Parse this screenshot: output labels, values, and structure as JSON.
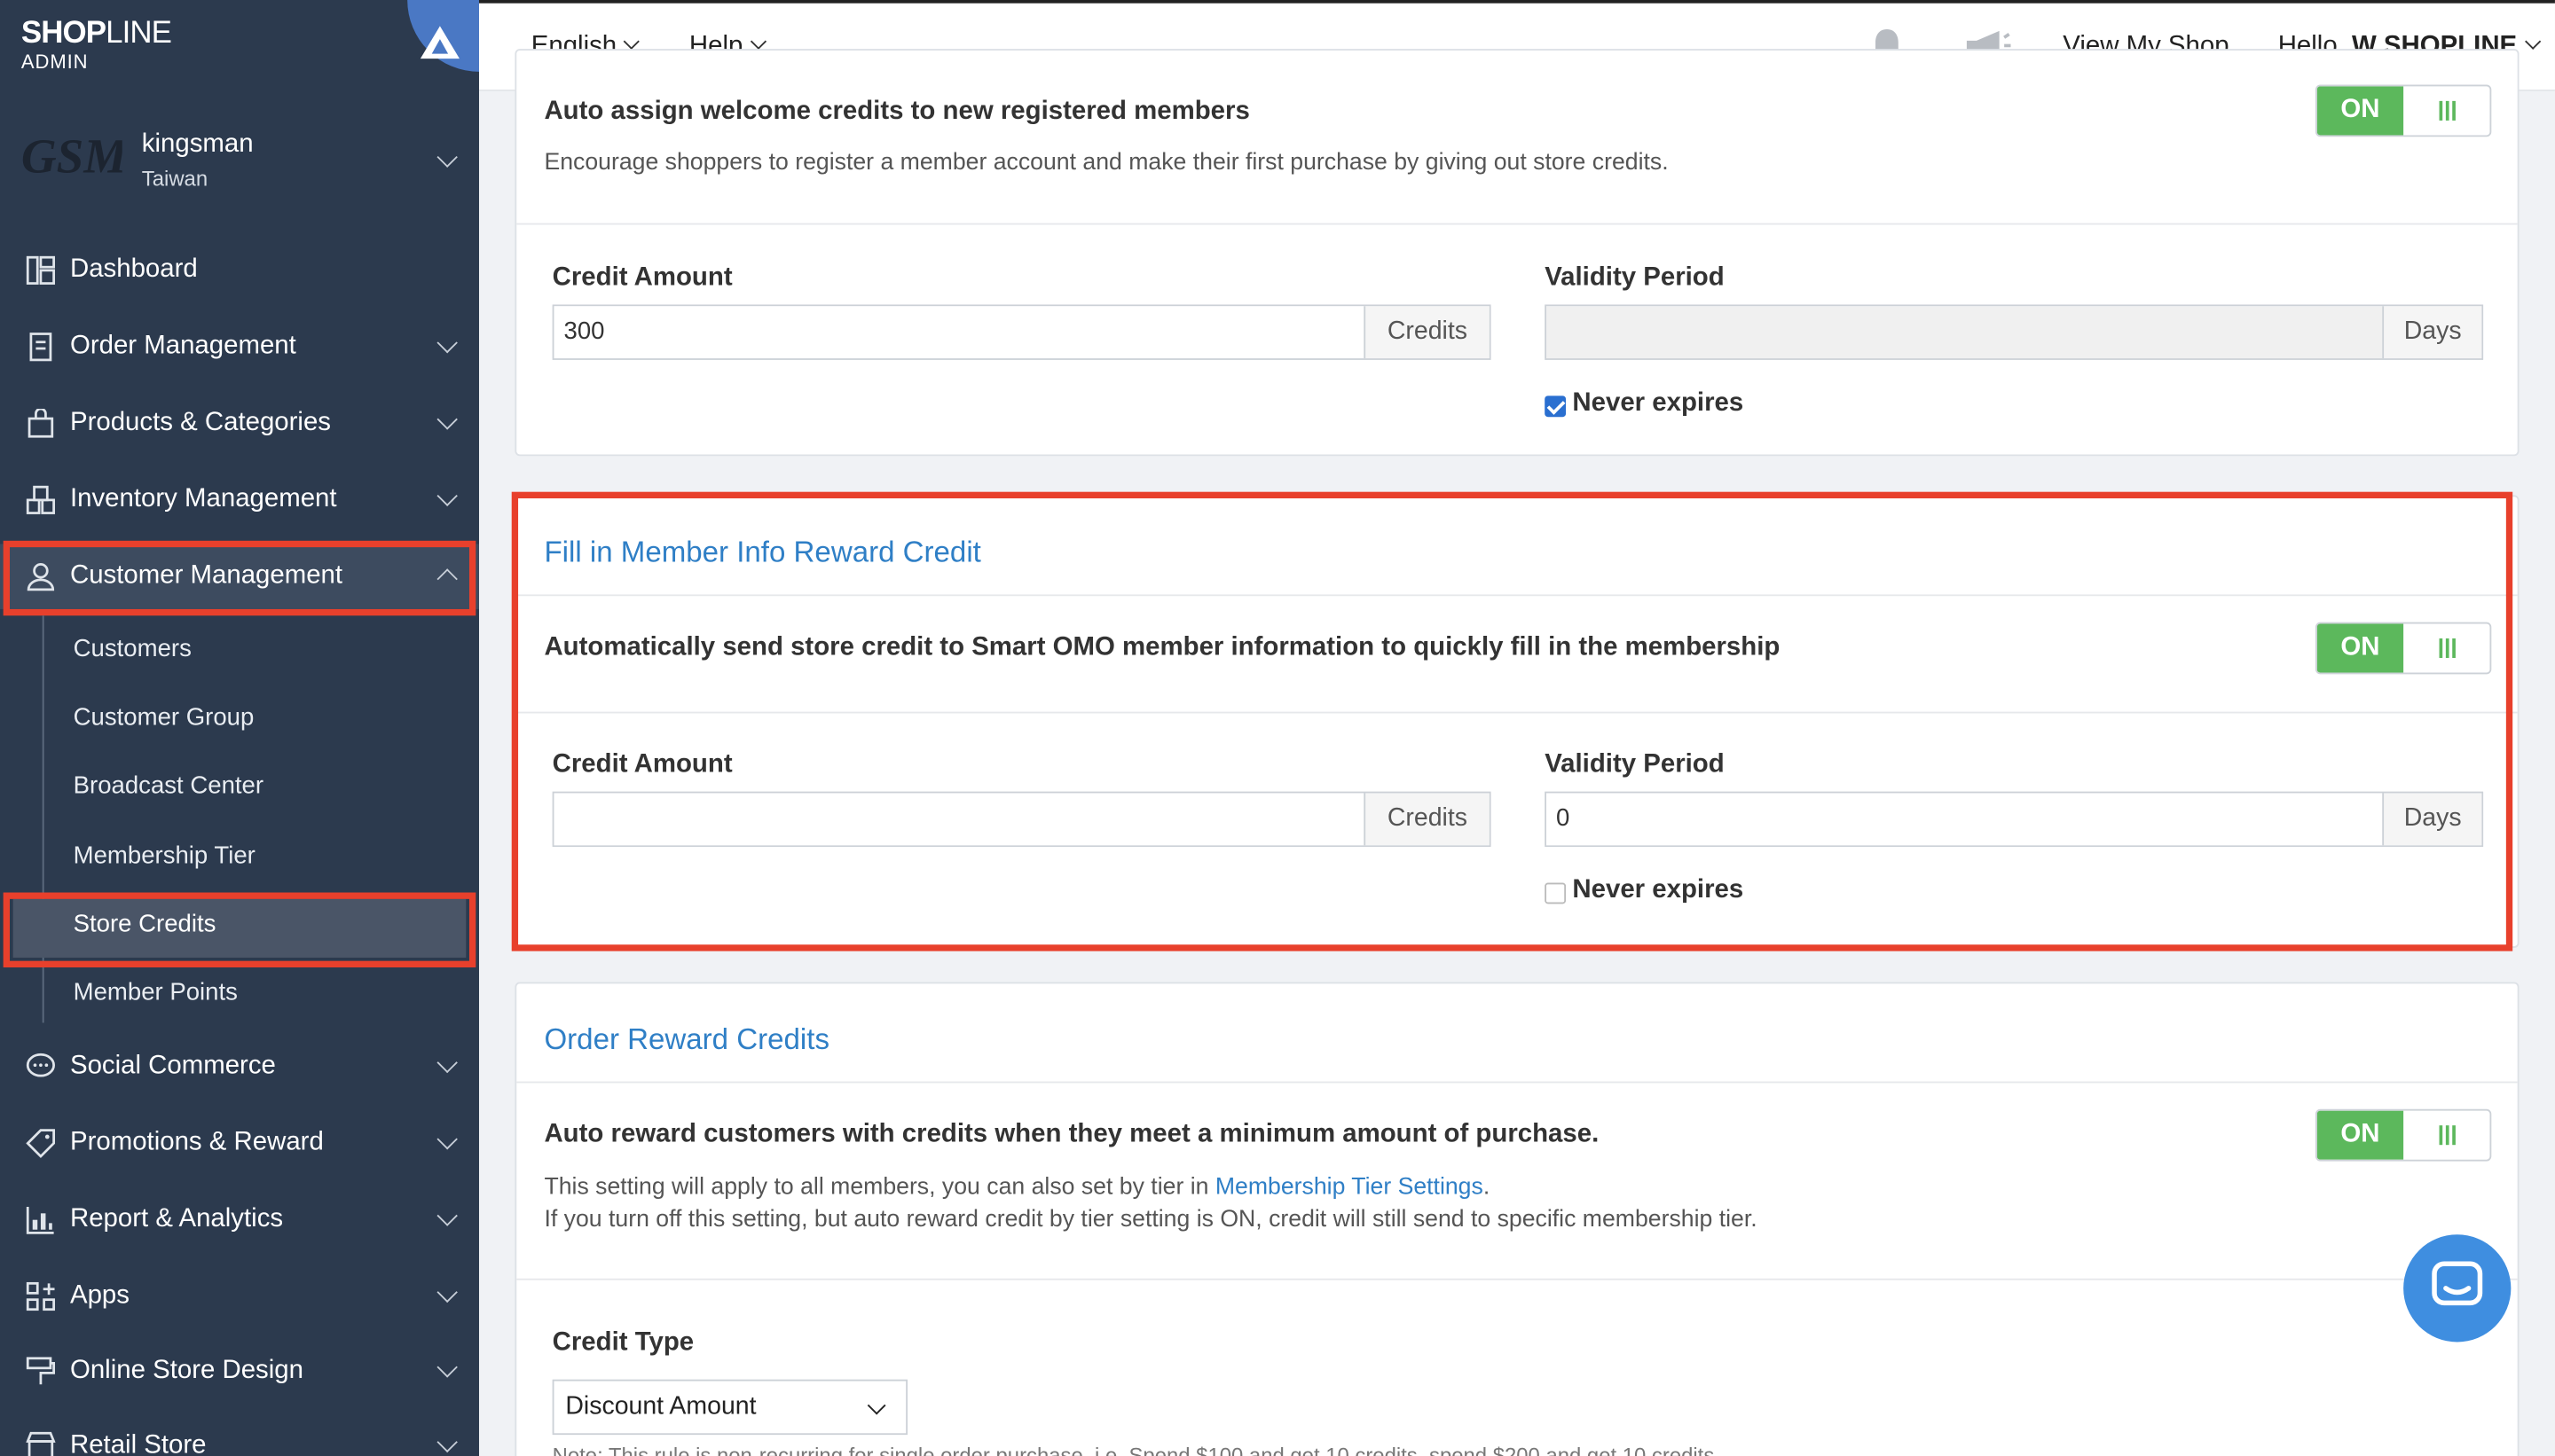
{
  "sidebar": {
    "brand": {
      "name_bold": "SHOP",
      "name_light": "LINE",
      "sub": "ADMIN"
    },
    "shop": {
      "logo_text": "GSM",
      "name": "kingsman",
      "region": "Taiwan"
    },
    "items": [
      {
        "label": "Dashboard",
        "icon": "dashboard-icon"
      },
      {
        "label": "Order Management",
        "icon": "order-icon"
      },
      {
        "label": "Products & Categories",
        "icon": "bag-icon"
      },
      {
        "label": "Inventory Management",
        "icon": "inventory-icon"
      },
      {
        "label": "Customer Management",
        "icon": "user-icon"
      },
      {
        "label": "Social Commerce",
        "icon": "chat-bubble-icon"
      },
      {
        "label": "Promotions & Reward",
        "icon": "tag-icon"
      },
      {
        "label": "Report & Analytics",
        "icon": "chart-icon"
      },
      {
        "label": "Apps",
        "icon": "apps-icon"
      },
      {
        "label": "Online Store Design",
        "icon": "brush-icon"
      },
      {
        "label": "Retail Store",
        "icon": "store-icon"
      }
    ],
    "subitems": [
      "Customers",
      "Customer Group",
      "Broadcast Center",
      "Membership Tier",
      "Store Credits",
      "Member Points"
    ]
  },
  "topbar": {
    "language": "English",
    "help": "Help",
    "view_shop": "View My Shop",
    "greeting": "Hello,",
    "user": "W SHOPLINE"
  },
  "welcome": {
    "title": "Auto assign welcome credits to new registered members",
    "desc": "Encourage shoppers to register a member account and make their first purchase by giving out store credits.",
    "toggle": "ON",
    "credit_label": "Credit Amount",
    "credit_value": "300",
    "credit_unit": "Credits",
    "validity_label": "Validity Period",
    "validity_value": "",
    "validity_unit": "Days",
    "never_expires": "Never expires",
    "never_expires_checked": true
  },
  "fill_info": {
    "header": "Fill in Member Info Reward Credit",
    "title": "Automatically send store credit to Smart OMO member information to quickly fill in the membership",
    "toggle": "ON",
    "credit_label": "Credit Amount",
    "credit_value": "",
    "credit_unit": "Credits",
    "validity_label": "Validity Period",
    "validity_value": "0",
    "validity_unit": "Days",
    "never_expires": "Never expires",
    "never_expires_checked": false
  },
  "order_reward": {
    "header": "Order Reward Credits",
    "title": "Auto reward customers with credits when they meet a minimum amount of purchase.",
    "toggle": "ON",
    "desc1_pre": "This setting will apply to all members, you can also set by tier in ",
    "desc1_link": "Membership Tier Settings",
    "desc1_post": ".",
    "desc2": "If you turn off this setting, but auto reward credit by tier setting is ON, credit will still send to specific membership tier.",
    "credit_type_label": "Credit Type",
    "credit_type_value": "Discount Amount",
    "note": "Note: This rule is non-recurring for single order purchase, i.e. Spend $100 and get 10 credits, spend $200 and get 10 credits."
  },
  "colors": {
    "sidebar": "#2c3a4e",
    "accent": "#2f7fc6",
    "toggle_on": "#5cb85c",
    "highlight": "#e8402c"
  }
}
